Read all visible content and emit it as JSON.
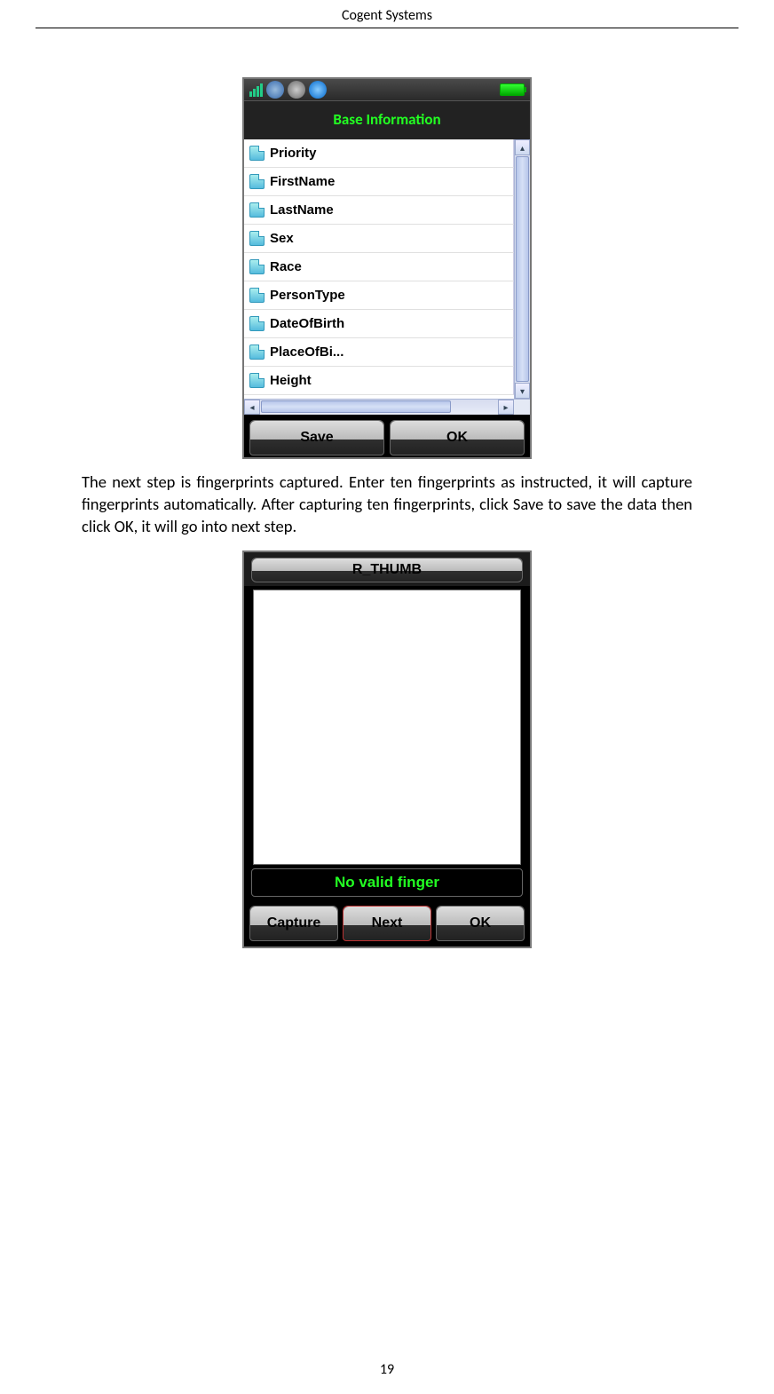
{
  "header": {
    "title": "Cogent Systems"
  },
  "device1": {
    "title": "Base Information",
    "fields": [
      "Priority",
      "FirstName",
      "LastName",
      "Sex",
      "Race",
      "PersonType",
      "DateOfBirth",
      "PlaceOfBi...",
      "Height"
    ],
    "buttons": {
      "save": "Save",
      "ok": "OK"
    }
  },
  "paragraph": "The next step is fingerprints captured. Enter ten fingerprints as instructed, it will capture fingerprints automatically. After capturing ten fingerprints, click Save to save the data then click OK, it will go into next step.",
  "device2": {
    "title": "R_THUMB",
    "status": "No valid finger",
    "buttons": {
      "capture": "Capture",
      "next": "Next",
      "ok": "OK"
    }
  },
  "page_number": "19"
}
